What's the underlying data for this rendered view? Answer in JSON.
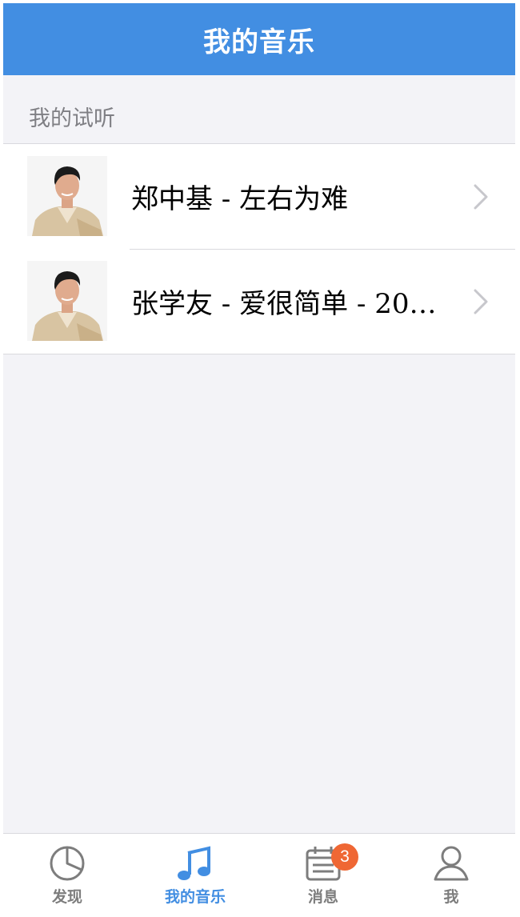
{
  "header": {
    "title": "我的音乐"
  },
  "section": {
    "title": "我的试听"
  },
  "songs": [
    {
      "title": "郑中基 - 左右为难",
      "thumbnail": "artist-photo"
    },
    {
      "title": "张学友 - 爱很简单 - 2004…",
      "thumbnail": "artist-photo"
    }
  ],
  "tabbar": {
    "tabs": [
      {
        "label": "发现",
        "icon": "pie-chart-icon",
        "active": false
      },
      {
        "label": "我的音乐",
        "icon": "music-note-icon",
        "active": true
      },
      {
        "label": "消息",
        "icon": "calendar-icon",
        "active": false,
        "badge": "3"
      },
      {
        "label": "我",
        "icon": "user-icon",
        "active": false
      }
    ]
  },
  "colors": {
    "accent": "#428ee2",
    "background": "#f3f3f7",
    "badge": "#ef6734",
    "inactive": "#7d7d7d"
  }
}
